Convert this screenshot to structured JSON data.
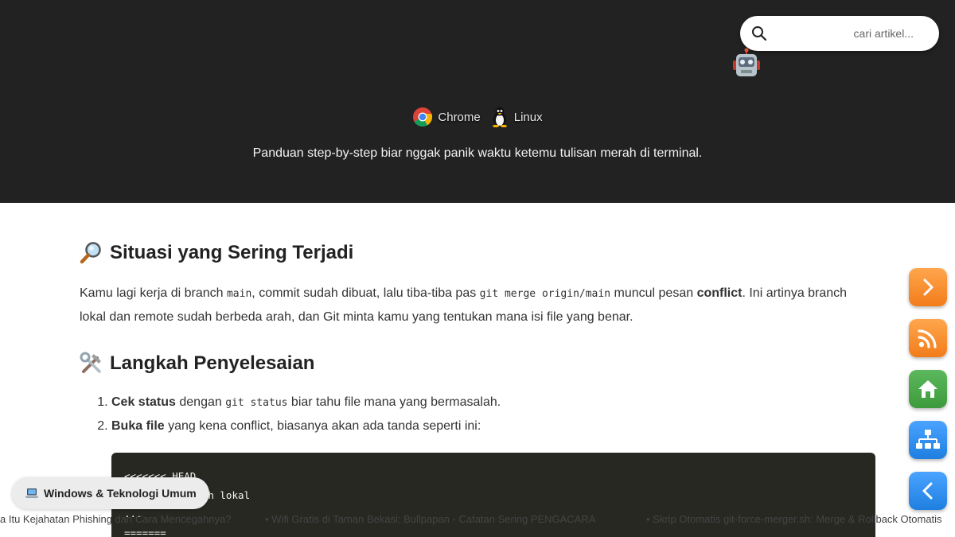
{
  "header": {
    "search_placeholder": "cari artikel...",
    "tags": [
      {
        "label": "Chrome",
        "icon": "chrome-icon"
      },
      {
        "label": "Linux",
        "icon": "linux-penguin-icon"
      }
    ],
    "subtitle": "Panduan step-by-step biar nggak panik waktu ketemu tulisan merah di terminal."
  },
  "section1": {
    "title": "Situasi yang Sering Terjadi",
    "icon": "magnifier-icon",
    "p1": "Kamu lagi kerja di branch ",
    "code1": "main",
    "p2": ", commit sudah dibuat, lalu tiba-tiba pas ",
    "code2": "git merge origin/main",
    "p3": " muncul pesan ",
    "bold1": "conflict",
    "p4": ". Ini artinya branch lokal dan remote sudah berbeda arah, dan Git minta kamu yang tentukan mana isi file yang benar."
  },
  "section2": {
    "title": "Langkah Penyelesaian",
    "icon": "tools-icon",
    "steps": [
      {
        "bold": "Cek status",
        "pre": " dengan ",
        "code": "git status",
        "post": " biar tahu file mana yang bermasalah."
      },
      {
        "bold": "Buka file",
        "post": " yang kena conflict, biasanya akan ada tanda seperti ini:"
      }
    ]
  },
  "codeblock": {
    "lines": [
      "<<<<<<< HEAD",
      "isi dari branch lokal",
      "...",
      "======="
    ]
  },
  "category_chip": {
    "icon": "laptop-icon",
    "label": "Windows & Teknologi Umum"
  },
  "ticker": {
    "items": [
      "a Itu Kejahatan Phishing dan Cara Mencegahnya?",
      "• Wifi Gratis di Taman Bekasi: Bullpapan - Catatan Sering PENGACARA",
      "• Skrip Otomatis git-force-merger.sh: Merge & Rollback Otomatis"
    ]
  },
  "side_nav": {
    "accent_orange": "#f27c1a",
    "accent_green": "#3c9a3c",
    "accent_blue": "#1e7fe0"
  }
}
